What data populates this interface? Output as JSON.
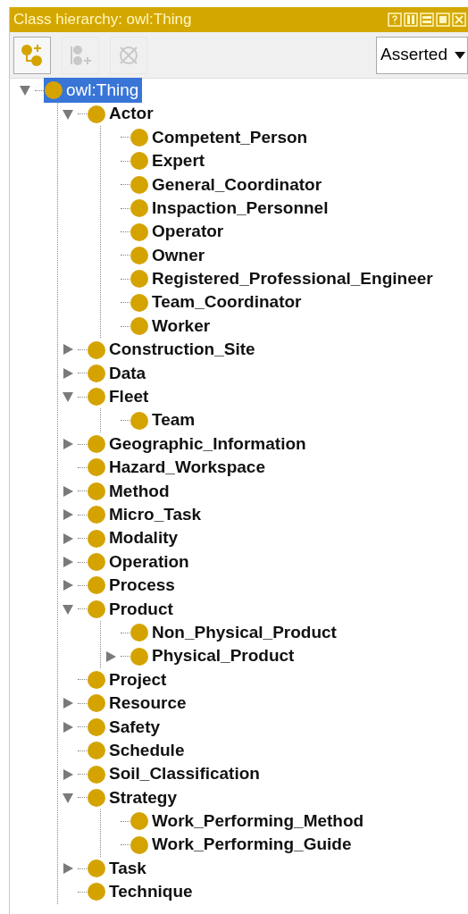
{
  "window": {
    "title": "Class hierarchy: owl:Thing"
  },
  "toolbar": {
    "buttons": [
      {
        "kind": "add-subclass",
        "disabled": false
      },
      {
        "kind": "add-sibling",
        "disabled": true
      },
      {
        "kind": "delete",
        "disabled": true
      }
    ],
    "view_select": {
      "value": "Asserted"
    }
  },
  "tree": [
    {
      "label": "owl:Thing",
      "expanded": true,
      "selected": true,
      "children": [
        {
          "label": "Actor",
          "expanded": true,
          "selected": false,
          "children": [
            {
              "label": "Competent_Person",
              "expanded": false,
              "selected": false
            },
            {
              "label": "Expert",
              "expanded": false,
              "selected": false
            },
            {
              "label": "General_Coordinator",
              "expanded": false,
              "selected": false
            },
            {
              "label": "Inspaction_Personnel",
              "expanded": false,
              "selected": false
            },
            {
              "label": "Operator",
              "expanded": false,
              "selected": false
            },
            {
              "label": "Owner",
              "expanded": false,
              "selected": false
            },
            {
              "label": "Registered_Professional_Engineer",
              "expanded": false,
              "selected": false
            },
            {
              "label": "Team_Coordinator",
              "expanded": false,
              "selected": false
            },
            {
              "label": "Worker",
              "expanded": false,
              "selected": false
            }
          ]
        },
        {
          "label": "Construction_Site",
          "expanded": false,
          "selected": false,
          "has_children": true
        },
        {
          "label": "Data",
          "expanded": false,
          "selected": false,
          "has_children": true
        },
        {
          "label": "Fleet",
          "expanded": true,
          "selected": false,
          "children": [
            {
              "label": "Team",
              "expanded": false,
              "selected": false
            }
          ]
        },
        {
          "label": "Geographic_Information",
          "expanded": false,
          "selected": false,
          "has_children": true
        },
        {
          "label": "Hazard_Workspace",
          "expanded": false,
          "selected": false
        },
        {
          "label": "Method",
          "expanded": false,
          "selected": false,
          "has_children": true
        },
        {
          "label": "Micro_Task",
          "expanded": false,
          "selected": false,
          "has_children": true
        },
        {
          "label": "Modality",
          "expanded": false,
          "selected": false,
          "has_children": true
        },
        {
          "label": "Operation",
          "expanded": false,
          "selected": false,
          "has_children": true
        },
        {
          "label": "Process",
          "expanded": false,
          "selected": false,
          "has_children": true
        },
        {
          "label": "Product",
          "expanded": true,
          "selected": false,
          "children": [
            {
              "label": "Non_Physical_Product",
              "expanded": false,
              "selected": false
            },
            {
              "label": "Physical_Product",
              "expanded": false,
              "selected": false,
              "has_children": true
            }
          ]
        },
        {
          "label": "Project",
          "expanded": false,
          "selected": false
        },
        {
          "label": "Resource",
          "expanded": false,
          "selected": false,
          "has_children": true
        },
        {
          "label": "Safety",
          "expanded": false,
          "selected": false,
          "has_children": true
        },
        {
          "label": "Schedule",
          "expanded": false,
          "selected": false
        },
        {
          "label": "Soil_Classification",
          "expanded": false,
          "selected": false,
          "has_children": true
        },
        {
          "label": "Strategy",
          "expanded": true,
          "selected": false,
          "children": [
            {
              "label": "Work_Performing_Method",
              "expanded": false,
              "selected": false
            },
            {
              "label": "Work_Performing_Guide",
              "expanded": false,
              "selected": false
            }
          ]
        },
        {
          "label": "Task",
          "expanded": false,
          "selected": false,
          "has_children": true
        },
        {
          "label": "Technique",
          "expanded": false,
          "selected": false
        }
      ]
    }
  ]
}
